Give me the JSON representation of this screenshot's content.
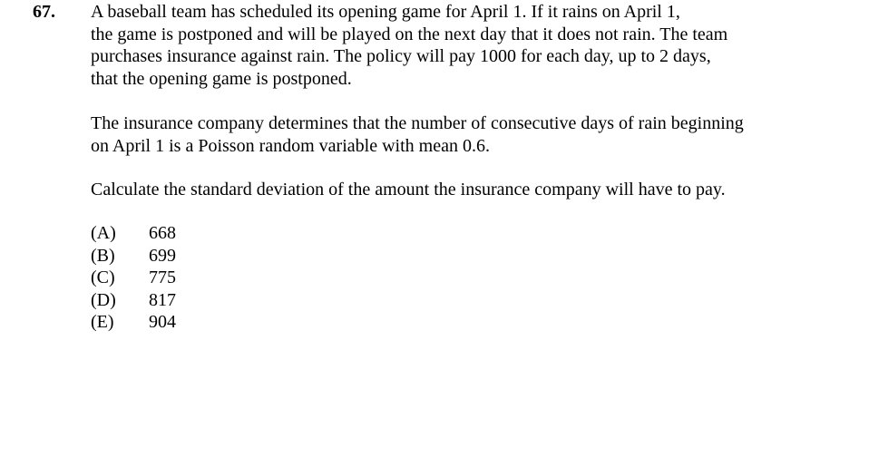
{
  "question": {
    "number": "67.",
    "paragraph1": [
      "A baseball team has scheduled its opening game for April 1.  If it rains on April 1,",
      "the game is postponed and will be played on the next day that it does not rain.  The team",
      "purchases insurance against rain.  The policy will pay 1000 for each day, up to 2 days,",
      "that the opening game is postponed."
    ],
    "paragraph2": [
      "The insurance company determines that the number of consecutive days of rain beginning",
      "on April 1 is a Poisson random variable with mean 0.6."
    ],
    "paragraph3": [
      "Calculate the standard deviation of the amount the insurance company will have to pay."
    ],
    "choices": [
      {
        "label": "(A)",
        "value": "668"
      },
      {
        "label": "(B)",
        "value": "699"
      },
      {
        "label": "(C)",
        "value": "775"
      },
      {
        "label": "(D)",
        "value": "817"
      },
      {
        "label": "(E)",
        "value": "904"
      }
    ]
  }
}
